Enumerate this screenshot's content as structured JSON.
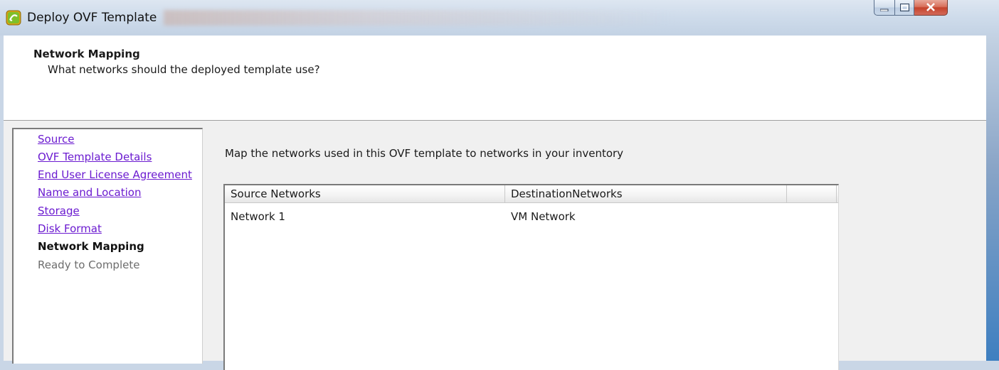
{
  "window": {
    "title": "Deploy OVF Template",
    "controls": {
      "minimize_icon": "minimize-icon",
      "maximize_icon": "maximize-icon",
      "close_icon": "close-icon"
    }
  },
  "header": {
    "title": "Network Mapping",
    "subtitle": "What networks should the deployed template use?"
  },
  "nav": {
    "items": [
      {
        "label": "Source",
        "state": "link"
      },
      {
        "label": "OVF Template Details",
        "state": "link"
      },
      {
        "label": "End User License Agreement",
        "state": "link"
      },
      {
        "label": "Name and Location",
        "state": "link"
      },
      {
        "label": "Storage",
        "state": "link"
      },
      {
        "label": "Disk Format",
        "state": "link"
      },
      {
        "label": "Network Mapping",
        "state": "current"
      },
      {
        "label": "Ready to Complete",
        "state": "pending"
      }
    ]
  },
  "main": {
    "instructions": "Map the networks used in this OVF template to networks in your inventory",
    "table": {
      "columns": [
        "Source Networks",
        "DestinationNetworks"
      ],
      "rows": [
        [
          "Network 1",
          "VM Network"
        ]
      ]
    }
  },
  "colors": {
    "link": "#6b1bd0",
    "header_bg": "#ffffff",
    "panel_bg": "#f0f0f0",
    "close_button": "#c5432b"
  }
}
